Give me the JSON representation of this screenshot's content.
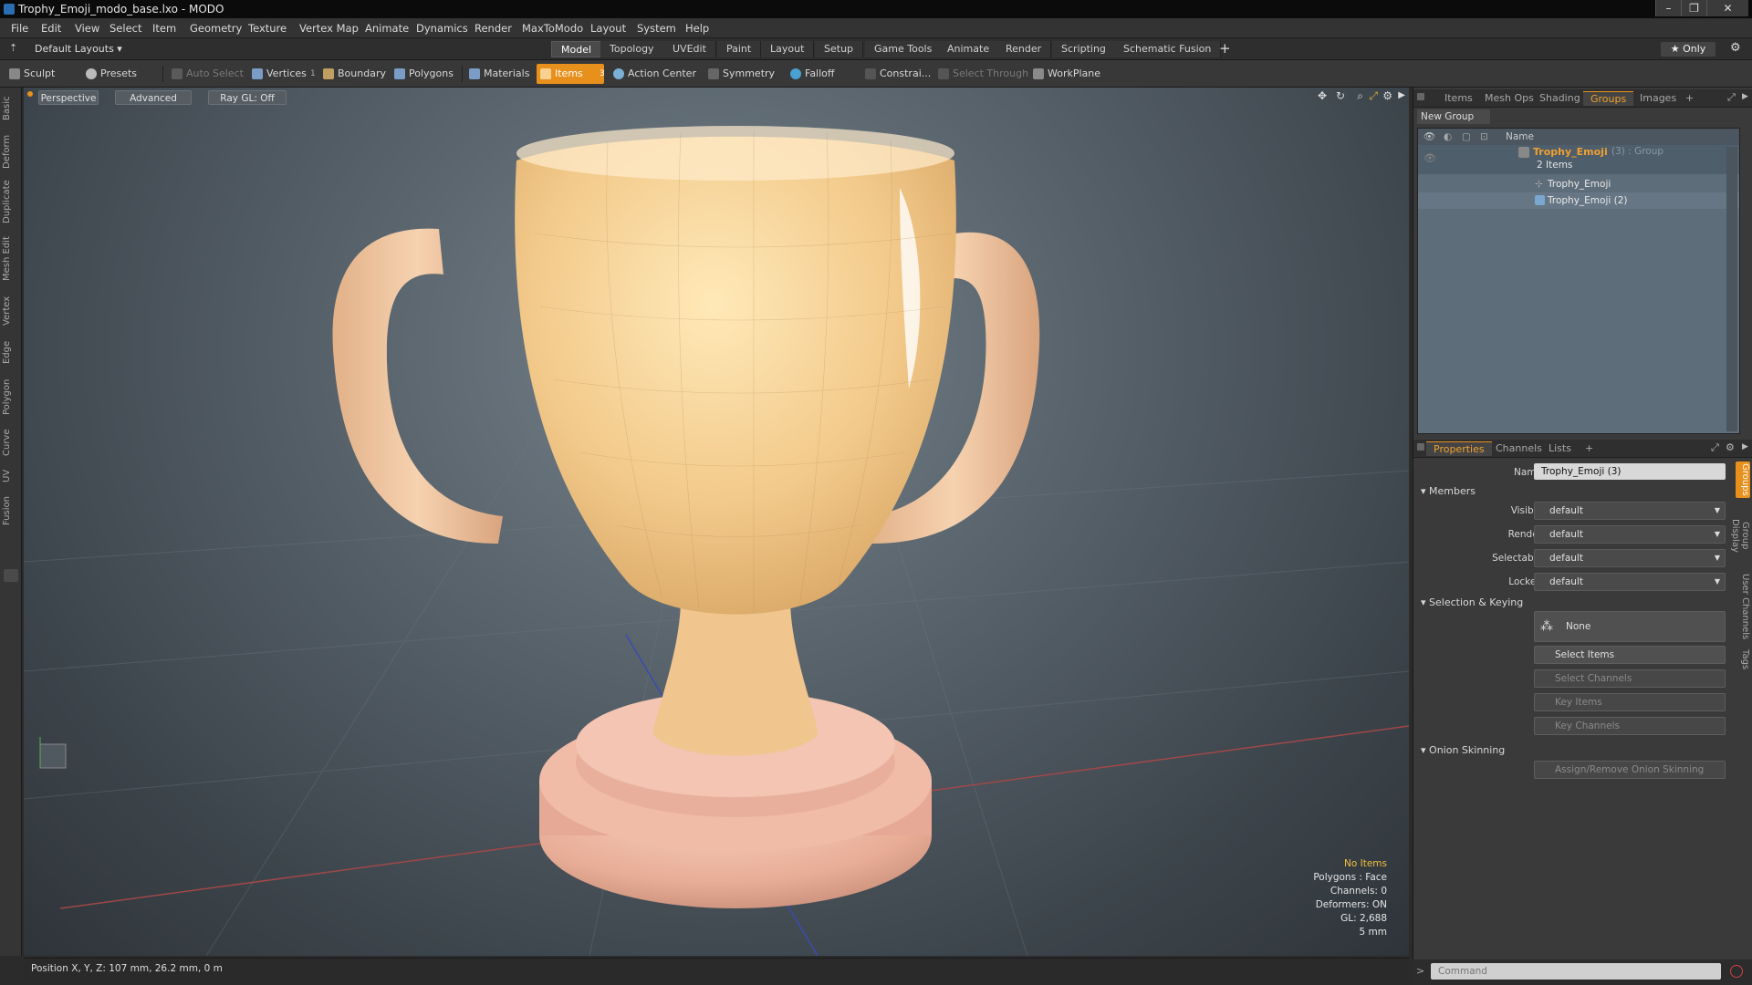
{
  "window": {
    "title": "Trophy_Emoji_modo_base.lxo - MODO"
  },
  "menu": [
    "File",
    "Edit",
    "View",
    "Select",
    "Item",
    "Geometry",
    "Texture",
    "Vertex Map",
    "Animate",
    "Dynamics",
    "Render",
    "MaxToModo",
    "Layout",
    "System",
    "Help"
  ],
  "layoutbar": {
    "preset": "Default Layouts ▾",
    "tabs": [
      "Model",
      "Topology",
      "UVEdit",
      "Paint",
      "Layout",
      "Setup",
      "Game Tools",
      "Animate",
      "Render",
      "Scripting",
      "Schematic Fusion"
    ],
    "active_tab": "Model",
    "add": "+",
    "only": "★ Only"
  },
  "toolbar": {
    "sculpt": "Sculpt",
    "presets": "Presets",
    "auto_select": "Auto Select",
    "vertices": "Vertices",
    "vertices_count": "1",
    "boundary": "Boundary",
    "polygons": "Polygons",
    "materials": "Materials",
    "items": "Items",
    "items_count": "3",
    "action_center": "Action Center",
    "symmetry": "Symmetry",
    "falloff": "Falloff",
    "constraint": "Constrai...",
    "select_through": "Select Through",
    "workplane": "WorkPlane"
  },
  "left_tabs": [
    "Basic",
    "Deform",
    "Duplicate",
    "Mesh Edit",
    "Vertex",
    "Edge",
    "Polygon",
    "Curve",
    "UV",
    "Fusion"
  ],
  "viewport": {
    "view": "Perspective",
    "shading": "Advanced",
    "raygl": "Ray GL: Off",
    "info": {
      "items": "No Items",
      "polygons": "Polygons : Face",
      "channels": "Channels: 0",
      "deformers": "Deformers: ON",
      "gl": "GL: 2,688",
      "scale": "5 mm"
    }
  },
  "status": {
    "position": "Position X, Y, Z:  107 mm, 26.2 mm, 0 m"
  },
  "groups_panel": {
    "tabs": [
      "Items",
      "Mesh Ops",
      "Shading",
      "Groups",
      "Images",
      "+"
    ],
    "active_tab": "Groups",
    "new_group": "New Group",
    "col_name": "Name",
    "group": {
      "name": "Trophy_Emoji",
      "suffix": "(3) : Group",
      "count": "2 Items"
    },
    "children": [
      "Trophy_Emoji",
      "Trophy_Emoji (2)"
    ]
  },
  "properties": {
    "tabs": [
      "Properties",
      "Channels",
      "Lists",
      "+"
    ],
    "active_tab": "Properties",
    "name_label": "Name",
    "name_value": "Trophy_Emoji (3)",
    "members": "Members",
    "visible_label": "Visible",
    "visible": "default",
    "render_label": "Render",
    "render": "default",
    "selectable_label": "Selectable",
    "selectable": "default",
    "locked_label": "Locked",
    "locked": "default",
    "sel_keying": "Selection & Keying",
    "none": "None",
    "select_items": "Select Items",
    "select_channels": "Select Channels",
    "key_items": "Key Items",
    "key_channels": "Key Channels",
    "onion": "Onion Skinning",
    "assign_onion": "Assign/Remove Onion Skinning"
  },
  "right_vtabs": [
    "Groups",
    "Group Display",
    "User Channels",
    "Tags"
  ],
  "command": {
    "placeholder": "Command"
  },
  "colors": {
    "accent": "#e8901c",
    "group_text": "#f0a030"
  }
}
